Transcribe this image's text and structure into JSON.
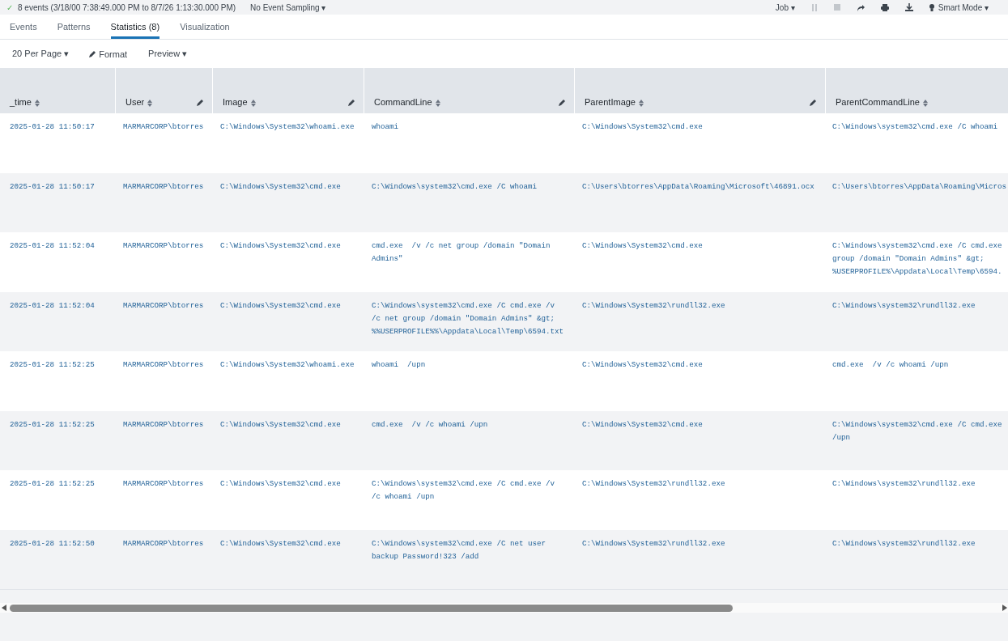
{
  "job_bar": {
    "status": "✓",
    "summary": "8 events (3/18/00 7:38:49.000 PM to 8/7/26 1:13:30.000 PM)",
    "sampling": "No Event Sampling ▾",
    "job": "Job ▾",
    "mode": "Smart Mode ▾"
  },
  "tabs": [
    {
      "label": "Events",
      "selected": false
    },
    {
      "label": "Patterns",
      "selected": false
    },
    {
      "label": "Statistics (8)",
      "selected": true
    },
    {
      "label": "Visualization",
      "selected": false
    }
  ],
  "toolbar": {
    "per_page": "20 Per Page ▾",
    "format": "Format",
    "preview": "Preview ▾"
  },
  "table": {
    "columns": [
      {
        "label": "_time",
        "editable": false
      },
      {
        "label": "User",
        "editable": true
      },
      {
        "label": "Image",
        "editable": true
      },
      {
        "label": "CommandLine",
        "editable": true
      },
      {
        "label": "ParentImage",
        "editable": true
      },
      {
        "label": "ParentCommandLine",
        "editable": false
      }
    ],
    "rows": [
      [
        "2025-01-28 11:50:17",
        "MARMARCORP\\btorres",
        "C:\\Windows\\System32\\whoami.exe",
        "whoami",
        "C:\\Windows\\System32\\cmd.exe",
        "C:\\Windows\\system32\\cmd.exe /C whoami"
      ],
      [
        "2025-01-28 11:50:17",
        "MARMARCORP\\btorres",
        "C:\\Windows\\System32\\cmd.exe",
        "C:\\Windows\\system32\\cmd.exe /C whoami",
        "C:\\Users\\btorres\\AppData\\Roaming\\Microsoft\\46891.ocx",
        "C:\\Users\\btorres\\AppData\\Roaming\\Micros"
      ],
      [
        "2025-01-28 11:52:04",
        "MARMARCORP\\btorres",
        "C:\\Windows\\System32\\cmd.exe",
        "cmd.exe  /v /c net group /domain \"Domain Admins\"",
        "C:\\Windows\\System32\\cmd.exe",
        "C:\\Windows\\system32\\cmd.exe /C cmd.exe\ngroup /domain \"Domain Admins\" &gt;\n%USERPROFILE%\\Appdata\\Local\\Temp\\6594."
      ],
      [
        "2025-01-28 11:52:04",
        "MARMARCORP\\btorres",
        "C:\\Windows\\System32\\cmd.exe",
        "C:\\Windows\\system32\\cmd.exe /C cmd.exe /v /c net group /domain \"Domain Admins\" &gt; %%USERPROFILE%%\\Appdata\\Local\\Temp\\6594.txt",
        "C:\\Windows\\System32\\rundll32.exe",
        "C:\\Windows\\system32\\rundll32.exe"
      ],
      [
        "2025-01-28 11:52:25",
        "MARMARCORP\\btorres",
        "C:\\Windows\\System32\\whoami.exe",
        "whoami  /upn",
        "C:\\Windows\\System32\\cmd.exe",
        "cmd.exe  /v /c whoami /upn"
      ],
      [
        "2025-01-28 11:52:25",
        "MARMARCORP\\btorres",
        "C:\\Windows\\System32\\cmd.exe",
        "cmd.exe  /v /c whoami /upn",
        "C:\\Windows\\System32\\cmd.exe",
        "C:\\Windows\\system32\\cmd.exe /C cmd.exe\n/upn"
      ],
      [
        "2025-01-28 11:52:25",
        "MARMARCORP\\btorres",
        "C:\\Windows\\System32\\cmd.exe",
        "C:\\Windows\\system32\\cmd.exe /C cmd.exe /v /c whoami /upn",
        "C:\\Windows\\System32\\rundll32.exe",
        "C:\\Windows\\system32\\rundll32.exe"
      ],
      [
        "2025-01-28 11:52:50",
        "MARMARCORP\\btorres",
        "C:\\Windows\\System32\\cmd.exe",
        "C:\\Windows\\system32\\cmd.exe /C net user backup Password!323 /add",
        "C:\\Windows\\System32\\rundll32.exe",
        "C:\\Windows\\system32\\rundll32.exe"
      ]
    ]
  }
}
